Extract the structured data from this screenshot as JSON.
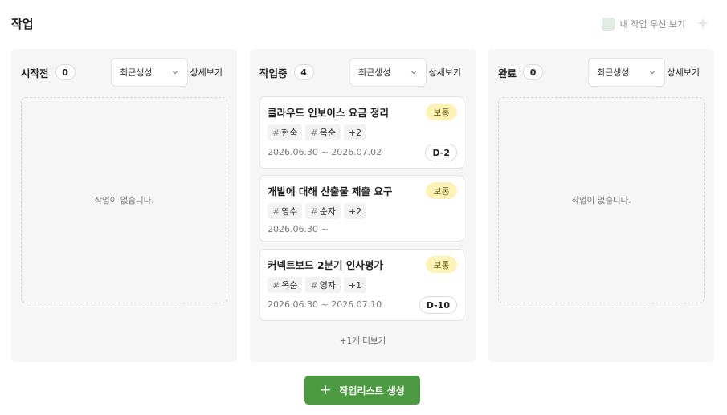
{
  "header": {
    "title": "작업",
    "my_tasks_first_label": "내 작업 우선 보기"
  },
  "columns": [
    {
      "title": "시작전",
      "count": "0",
      "sort": "최근생성",
      "detail": "상세보기",
      "empty_text": "작업이 없습니다."
    },
    {
      "title": "작업중",
      "count": "4",
      "sort": "최근생성",
      "detail": "상세보기",
      "more": "+1개 더보기",
      "cards": [
        {
          "title": "클라우드 인보이스 요금 정리",
          "priority": "보통",
          "tags": [
            "현숙",
            "옥순"
          ],
          "extra": "+2",
          "date": "2026.06.30 ~ 2026.07.02",
          "dday": "D-2"
        },
        {
          "title": "개발에 대해 산출물 제출 요구",
          "priority": "보통",
          "tags": [
            "영수",
            "순자"
          ],
          "extra": "+2",
          "date": "2026.06.30 ~"
        },
        {
          "title": "커넥트보드 2분기 인사평가",
          "priority": "보통",
          "tags": [
            "옥순",
            "영자"
          ],
          "extra": "+1",
          "date": "2026.06.30 ~ 2026.07.10",
          "dday": "D-10"
        }
      ]
    },
    {
      "title": "완료",
      "count": "0",
      "sort": "최근생성",
      "detail": "상세보기",
      "empty_text": "작업이 없습니다."
    }
  ],
  "footer": {
    "create_label": "작업리스트 생성"
  },
  "colors": {
    "accent": "#4c9b43",
    "priority_bg": "#fdf3b9"
  }
}
